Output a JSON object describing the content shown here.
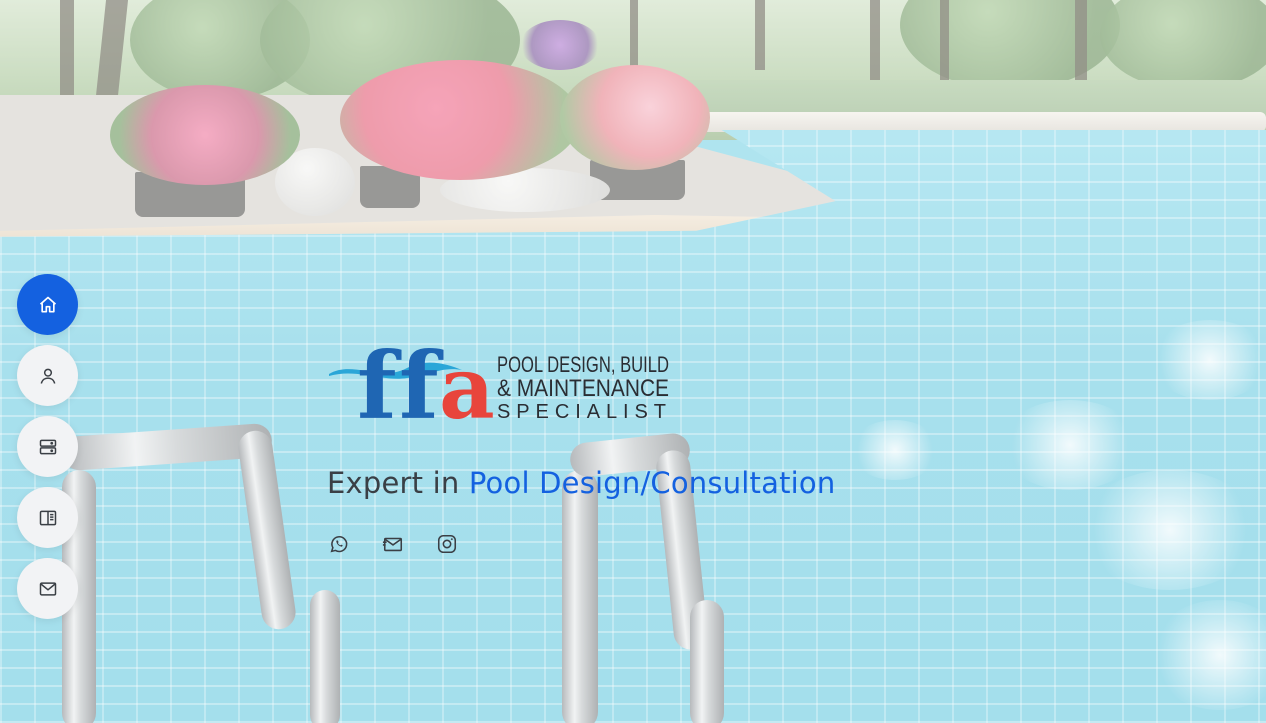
{
  "nav": {
    "items": [
      {
        "icon": "home-icon",
        "active": true
      },
      {
        "icon": "user-icon",
        "active": false
      },
      {
        "icon": "server-icon",
        "active": false
      },
      {
        "icon": "book-icon",
        "active": false
      },
      {
        "icon": "mail-icon",
        "active": false
      }
    ],
    "active_color": "#1461e0",
    "inactive_color": "#f2f3f5"
  },
  "hero": {
    "logo": {
      "letters": [
        "f",
        "f",
        "a"
      ],
      "line1": "POOL DESIGN, BUILD",
      "line2": "& MAINTENANCE",
      "line3": "SPECIALIST",
      "colors": {
        "f1": "#1f66b3",
        "f2": "#1f66b3",
        "a": "#e8453c",
        "wave": "#2aa6d8"
      }
    },
    "tagline_prefix": "Expert in",
    "tagline_highlight": "Pool Design/Consultation"
  },
  "social": [
    {
      "icon": "whatsapp-icon"
    },
    {
      "icon": "email-send-icon"
    },
    {
      "icon": "instagram-icon"
    }
  ]
}
